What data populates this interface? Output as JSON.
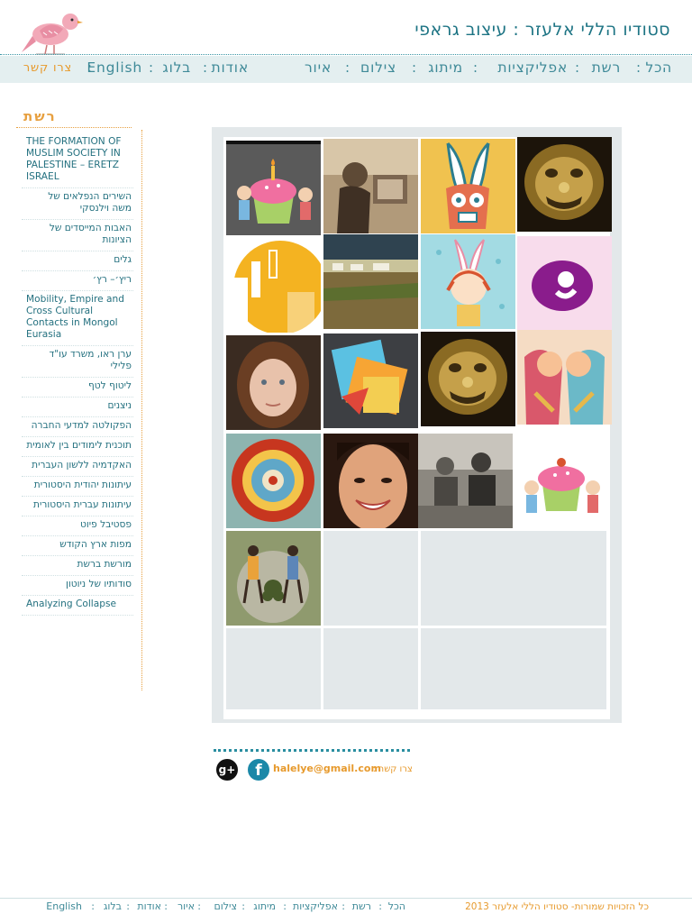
{
  "header": {
    "title": "סטודיו הללי אלעזר : עיצוב גראפי",
    "logo_icon": "bird-icon"
  },
  "nav": {
    "items": [
      "הכל",
      "רשת",
      "אפליקציות",
      "מיתוג",
      "צילום",
      "איור",
      "אודות",
      "בלוג",
      "English"
    ],
    "contact": "צרו קשר",
    "separator": ":"
  },
  "sidebar": {
    "heading": "רשת",
    "items": [
      "THE FORMATION OF MUSLIM SOCIETY IN PALESTINE – ERETZ ISRAEL",
      "השירים הנפלאים של משה וילנסקי",
      "האבות המייסדים של הציונות",
      "גלים",
      "ריץ׳– רץ׳",
      "Mobility, Empire and Cross Cultural Contacts in Mongol Eurasia",
      "ערן ראו, משרד עו\"ד פלילי",
      "ליטוף לטף",
      "ניצנים",
      "הפקולטה למדעי החברה",
      "תוכנית לימודים בין לאומית",
      "האקדמיה ללשון העברית",
      "עיתונות יהודית היסטורית",
      "עיתונות עברית היסטורית",
      "פסטיבל פיוט",
      "מפות ארץ הקודש",
      "מורשת ברשת",
      "סודותיו של ניוטון",
      "Analyzing Collapse"
    ]
  },
  "grid": {
    "tiles": [
      "cupcake-birthday-image",
      "archival-photo-image",
      "bunny-illustration-image",
      "golden-lion-image",
      "yellow-city-image",
      "mongol-steppe-image",
      "bunny-girl-image",
      "purple-logo-image",
      "girl-portrait-image",
      "colorful-collage-image",
      "golden-lion-image",
      "kissing-couple-image",
      "rose-ornament-image",
      "smiling-woman-image",
      "old-group-photo-image",
      "cupcake-kids-image",
      "musicians-illustration-image"
    ],
    "empty_count": 7
  },
  "contact": {
    "label": "צרו קשר :",
    "email": "halelye@gmail.com",
    "facebook_icon": "f",
    "google_icon": "g+"
  },
  "footer": {
    "copyright": "כל הזכויות שמורות- סטודיו הללי אלעזר 2013",
    "links": [
      "הכל",
      "רשת",
      "אפליקציות",
      "מיתוג",
      "צילום",
      "איור",
      "אודות",
      "בלוג",
      "English"
    ],
    "separator": ":"
  },
  "colors": {
    "accent": "#1d7484",
    "orange": "#e79a2d",
    "nav_bg": "#e4eff0",
    "grid_bg": "#e3e8ea"
  }
}
